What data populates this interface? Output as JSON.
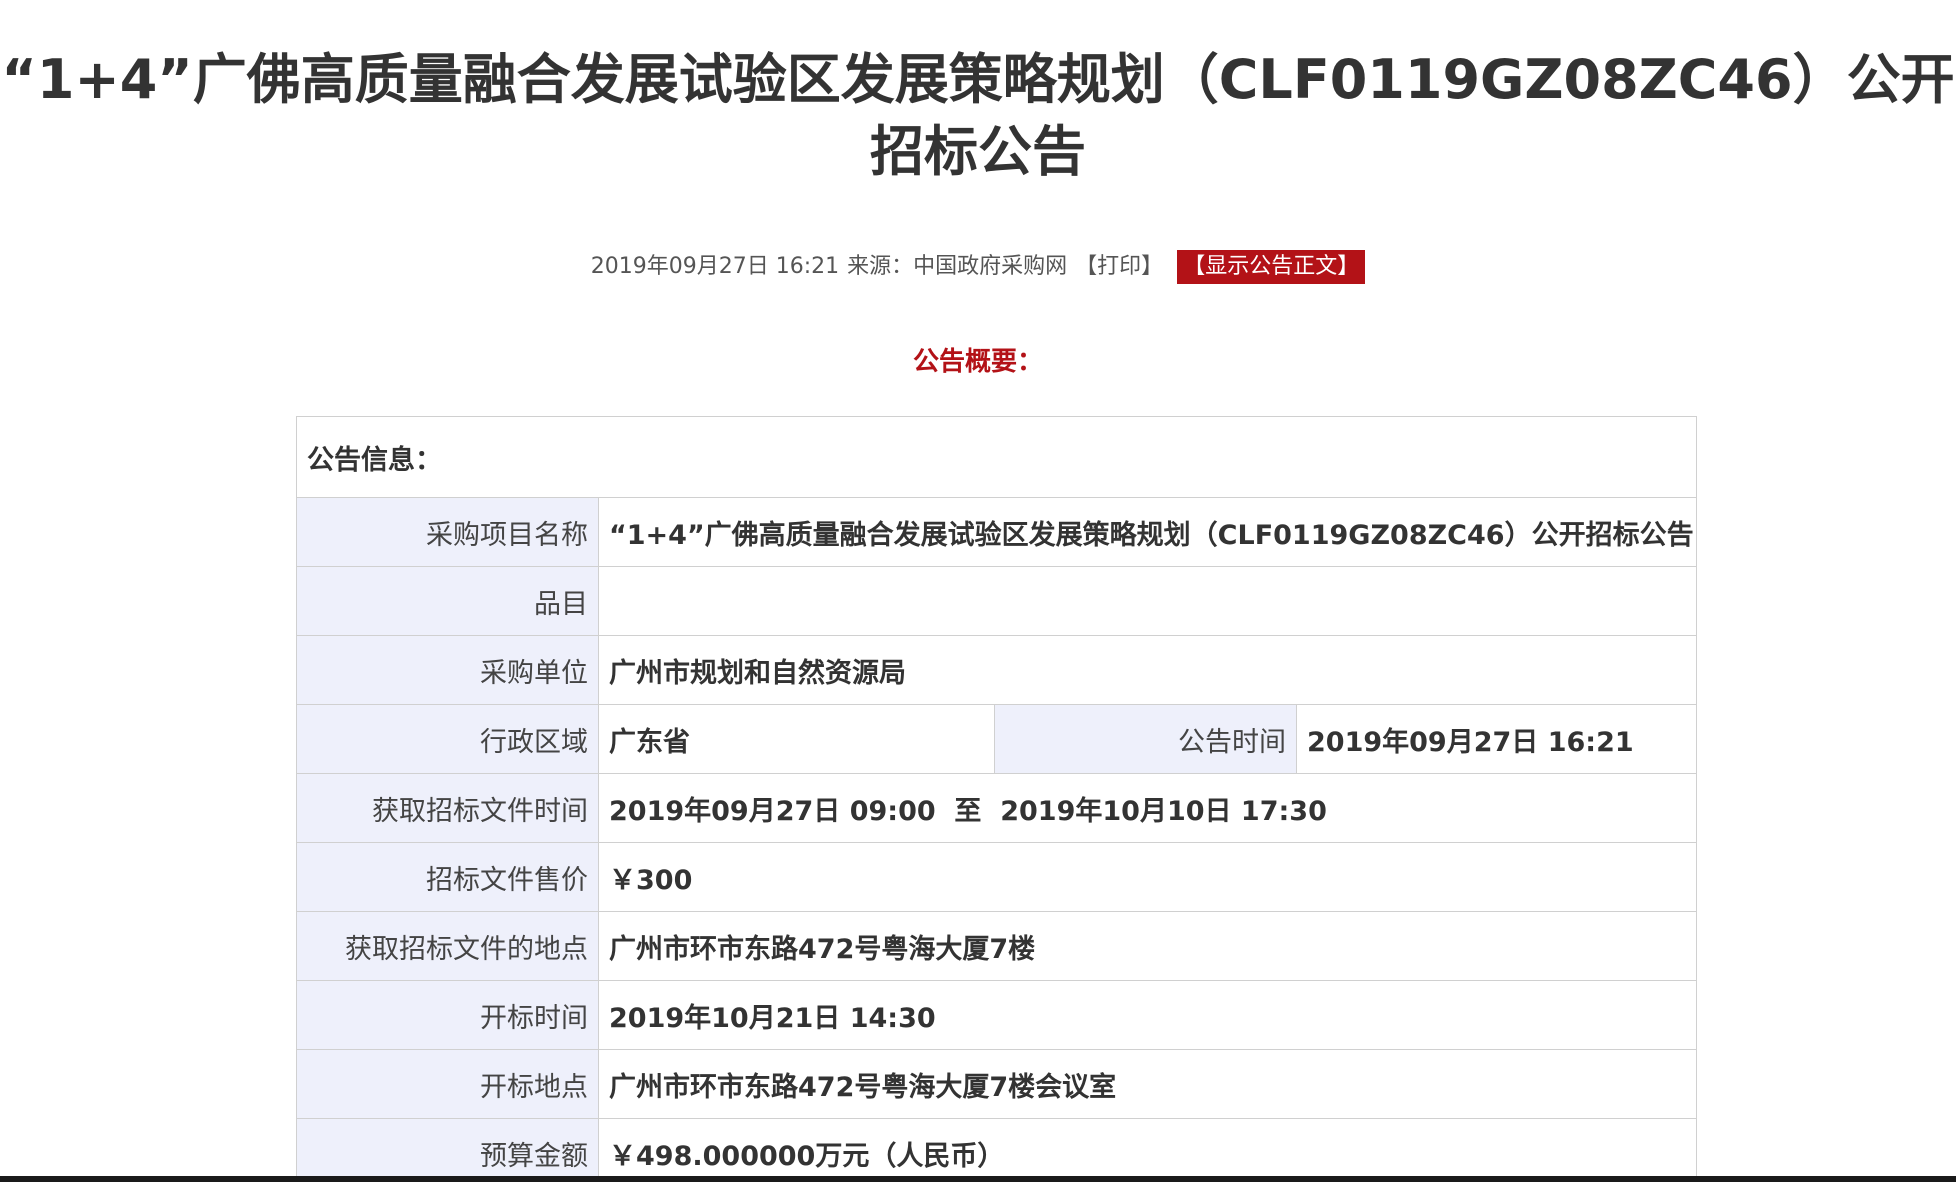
{
  "title": "“1+4”广佛高质量融合发展试验区发展策略规划（CLF0119GZ08ZC46）公开招标公告",
  "meta": {
    "datetime": "2019年09月27日 16:21",
    "source": "来源：中国政府采购网",
    "print_label": "【打印】",
    "show_text_button": "【显示公告正文】"
  },
  "summary_heading": "公告概要：",
  "table": {
    "header": "公告信息：",
    "rows": {
      "project_name": {
        "label": "采购项目名称",
        "value": "“1+4”广佛高质量融合发展试验区发展策略规划（CLF0119GZ08ZC46）公开招标公告"
      },
      "category": {
        "label": "品目",
        "value": ""
      },
      "purchaser": {
        "label": "采购单位",
        "value": "广州市规划和自然资源局"
      },
      "region": {
        "label": "行政区域",
        "value": "广东省"
      },
      "announce_time": {
        "label": "公告时间",
        "value": "2019年09月27日 16:21"
      },
      "doc_time": {
        "label": "获取招标文件时间",
        "value": "2019年09月27日 09:00  至  2019年10月10日 17:30"
      },
      "doc_price": {
        "label": "招标文件售价",
        "value": "￥300"
      },
      "doc_location": {
        "label": "获取招标文件的地点",
        "value": "广州市环市东路472号粤海大厦7楼"
      },
      "open_time": {
        "label": "开标时间",
        "value": "2019年10月21日 14:30"
      },
      "open_location": {
        "label": "开标地点",
        "value": "广州市环市东路472号粤海大厦7楼会议室"
      },
      "budget": {
        "label": "预算金额",
        "value": "￥498.000000万元（人民币）"
      }
    }
  },
  "colors": {
    "accent_red": "#b31217",
    "label_bg": "#eef0fb",
    "border": "#d0d0d0"
  }
}
